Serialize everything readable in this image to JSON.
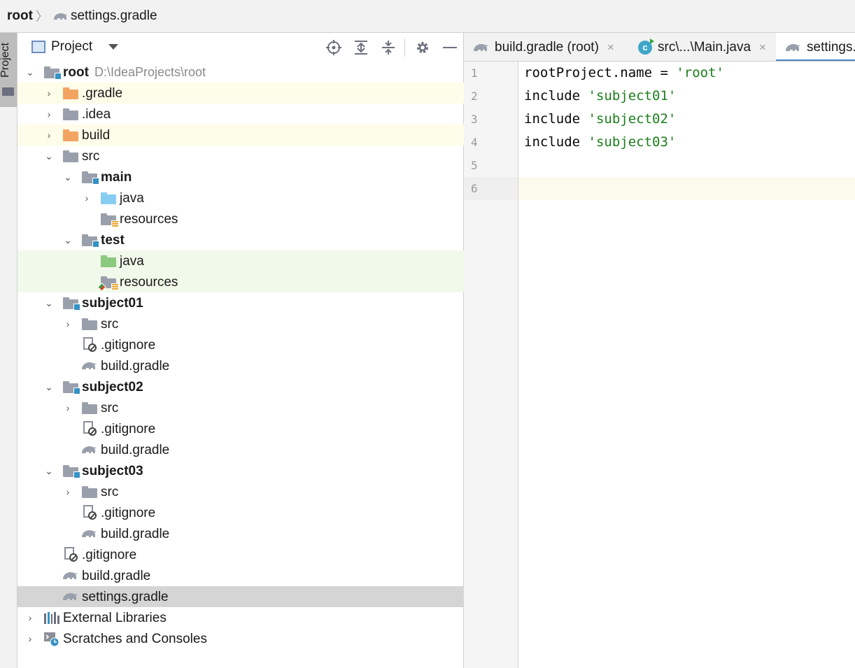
{
  "navbar": {
    "root": "root",
    "file": "settings.gradle"
  },
  "left_strip": {
    "project_tab": "Project"
  },
  "project_panel": {
    "title": "Project",
    "tree": [
      {
        "label": "root",
        "path": "D:\\IdeaProjects\\root"
      },
      {
        "label": ".gradle"
      },
      {
        "label": ".idea"
      },
      {
        "label": "build"
      },
      {
        "label": "src"
      },
      {
        "label": "main"
      },
      {
        "label": "java"
      },
      {
        "label": "resources"
      },
      {
        "label": "test"
      },
      {
        "label": "java"
      },
      {
        "label": "resources"
      },
      {
        "label": "subject01"
      },
      {
        "label": "src"
      },
      {
        "label": ".gitignore"
      },
      {
        "label": "build.gradle"
      },
      {
        "label": "subject02"
      },
      {
        "label": "src"
      },
      {
        "label": ".gitignore"
      },
      {
        "label": "build.gradle"
      },
      {
        "label": "subject03"
      },
      {
        "label": "src"
      },
      {
        "label": ".gitignore"
      },
      {
        "label": "build.gradle"
      },
      {
        "label": ".gitignore"
      },
      {
        "label": "build.gradle"
      },
      {
        "label": "settings.gradle"
      },
      {
        "label": "External Libraries"
      },
      {
        "label": "Scratches and Consoles"
      }
    ]
  },
  "editor": {
    "tabs": [
      {
        "label": "build.gradle (root)",
        "close": "×"
      },
      {
        "label": "src\\...\\Main.java",
        "close": "×"
      },
      {
        "label": "settings.gradle"
      }
    ],
    "line_numbers": [
      "1",
      "2",
      "3",
      "4",
      "5",
      "6"
    ],
    "lines": [
      {
        "code": "rootProject.name = ",
        "str": "'root'"
      },
      {
        "code": "include ",
        "str": "'subject01'"
      },
      {
        "code": "include ",
        "str": "'subject02'"
      },
      {
        "code": "include ",
        "str": "'subject03'"
      },
      {
        "code": "",
        "str": ""
      },
      {
        "code": "",
        "str": ""
      }
    ]
  },
  "colors": {
    "accent": "#4a86c8",
    "string": "#1a7f1a",
    "module_badge": "#3592c4",
    "excluded_folder": "#f4a462",
    "source_folder": "#87cdf2",
    "test_folder": "#8bc97f"
  }
}
